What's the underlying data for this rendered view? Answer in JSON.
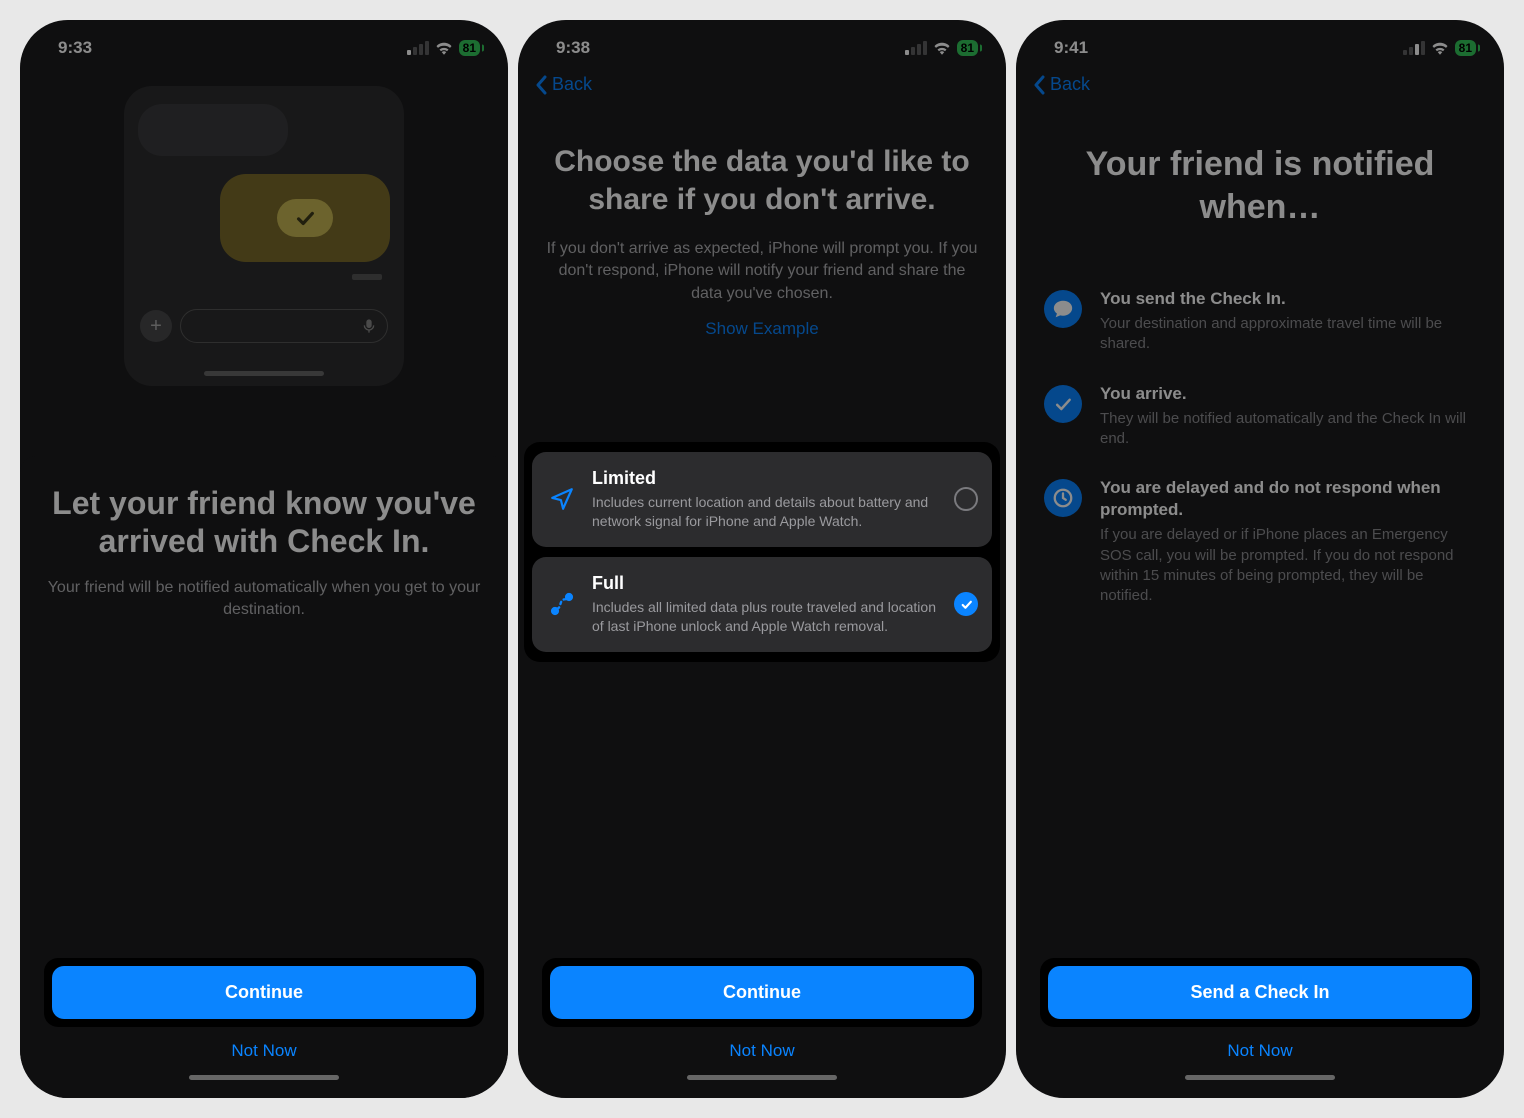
{
  "screens": [
    {
      "status": {
        "time": "9:33",
        "battery": "81"
      },
      "title": "Let your friend know you've arrived with Check In.",
      "subtitle": "Your friend will be notified automatically when you get to your destination.",
      "primary_button": "Continue",
      "secondary_button": "Not Now"
    },
    {
      "status": {
        "time": "9:38",
        "battery": "81"
      },
      "back_label": "Back",
      "title": "Choose the data you'd like to share if you don't arrive.",
      "subtitle": "If you don't arrive as expected, iPhone will prompt you. If you don't respond, iPhone will notify your friend and share the data you've chosen.",
      "show_example": "Show Example",
      "options": [
        {
          "title": "Limited",
          "desc": "Includes current location and details about battery and network signal for iPhone and Apple Watch.",
          "selected": false
        },
        {
          "title": "Full",
          "desc": "Includes all limited data plus route traveled and location of last iPhone unlock and Apple Watch removal.",
          "selected": true
        }
      ],
      "primary_button": "Continue",
      "secondary_button": "Not Now"
    },
    {
      "status": {
        "time": "9:41",
        "battery": "81"
      },
      "back_label": "Back",
      "title": "Your friend is notified when…",
      "info": [
        {
          "title": "You send the Check In.",
          "desc": "Your destination and approximate travel time will be shared."
        },
        {
          "title": "You arrive.",
          "desc": "They will be notified automatically and the Check In will end."
        },
        {
          "title": "You are delayed and do not respond when prompted.",
          "desc": "If you are delayed or if iPhone places an Emergency SOS call, you will be prompted. If you do not respond within 15 minutes of being prompted, they will be notified."
        }
      ],
      "primary_button": "Send a Check In",
      "secondary_button": "Not Now"
    }
  ]
}
